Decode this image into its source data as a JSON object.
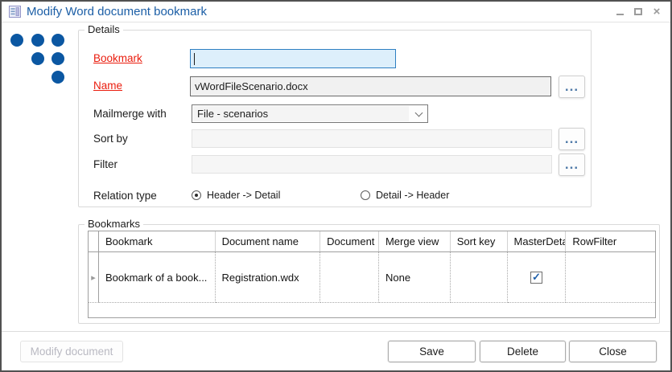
{
  "window": {
    "title": "Modify Word document bookmark"
  },
  "icons": {
    "browse": "...",
    "row_selector": "▸",
    "close": "×"
  },
  "details": {
    "legend": "Details",
    "bookmark": {
      "label": "Bookmark",
      "value": "",
      "required": true
    },
    "name": {
      "label": "Name",
      "value": "vWordFileScenario.docx",
      "required": true
    },
    "mailmerge": {
      "label": "Mailmerge with",
      "value": "File - scenarios"
    },
    "sortby": {
      "label": "Sort by",
      "value": ""
    },
    "filter": {
      "label": "Filter",
      "value": ""
    },
    "relation": {
      "label": "Relation type",
      "options": [
        {
          "label": "Header -> Detail",
          "selected": true
        },
        {
          "label": "Detail -> Header",
          "selected": false
        }
      ]
    }
  },
  "bookmarks": {
    "legend": "Bookmarks",
    "table": {
      "columns": [
        "Bookmark",
        "Document name",
        "Document",
        "Merge view",
        "Sort key",
        "MasterDetail",
        "RowFilter"
      ],
      "rows": [
        {
          "bookmark": "Bookmark of a book...",
          "document_name": "Registration.wdx",
          "document": "",
          "merge_view": "None",
          "sort_key": "",
          "master_detail": true,
          "row_filter": ""
        }
      ]
    }
  },
  "buttons": {
    "modify": {
      "label": "Modify document",
      "enabled": false
    },
    "save": "Save",
    "delete": "Delete",
    "close": "Close"
  },
  "colors": {
    "accent_blue": "#0b57a2",
    "title_blue": "#1b5ea6",
    "required_red": "#ea1c0d",
    "focused_field_bg": "#ddeffb",
    "focused_field_border": "#2e7fc2",
    "check_blue": "#1f5fa9"
  }
}
